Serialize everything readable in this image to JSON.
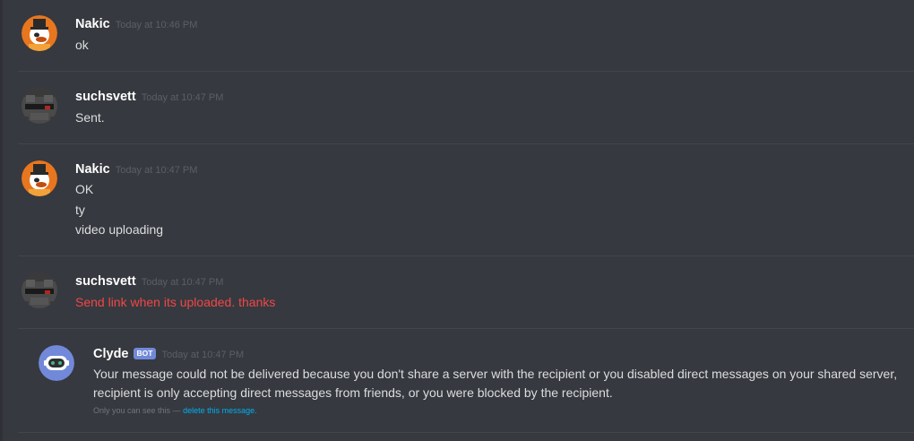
{
  "messages": [
    {
      "author": "Nakic",
      "timestamp": "Today at 10:46 PM",
      "avatar_icon": "duck-top-hat-icon",
      "lines": [
        "ok"
      ]
    },
    {
      "author": "suchsvett",
      "timestamp": "Today at 10:47 PM",
      "avatar_icon": "pixel-face-icon",
      "lines": [
        "Sent."
      ]
    },
    {
      "author": "Nakic",
      "timestamp": "Today at 10:47 PM",
      "avatar_icon": "duck-top-hat-icon",
      "lines": [
        "OK",
        "ty",
        "video uploading"
      ]
    },
    {
      "author": "suchsvett",
      "timestamp": "Today at 10:47 PM",
      "avatar_icon": "pixel-face-icon",
      "lines": [
        "Send link when its uploaded. thanks"
      ],
      "failed": true
    }
  ],
  "clyde": {
    "author": "Clyde",
    "bot_tag": "BOT",
    "timestamp": "Today at 10:47 PM",
    "avatar_icon": "clyde-robot-icon",
    "line1": "Your message could not be delivered because you don't share a server with the recipient or you disabled direct messages on your shared server,",
    "line2": "recipient is only accepting direct messages from friends, or you were blocked by the recipient.",
    "ephemeral_note": "Only you can see this —",
    "delete_link": "delete this message."
  },
  "colors": {
    "background": "#36393f",
    "username": "#ffffff",
    "message_text": "#dcddde",
    "failed_text": "#f04747",
    "timestamp": "#5c5f66",
    "bot_tag": "#7289da",
    "link": "#00b0f4",
    "clyde_avatar": "#7289da"
  }
}
